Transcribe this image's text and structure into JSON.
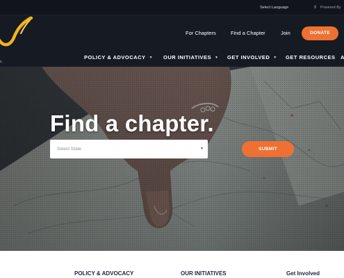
{
  "utility": {
    "language_label": "Select Language",
    "powered_by": "Powered By"
  },
  "header": {
    "logo_icon": "swoosh-logo",
    "logo_fragment": "c.",
    "top_links": [
      "For Chapters",
      "Find a Chapter",
      "Join"
    ],
    "donate_label": "DONATE",
    "main_nav": [
      {
        "label": "POLICY & ADVOCACY",
        "has_dropdown": true
      },
      {
        "label": "OUR INITIATIVES",
        "has_dropdown": true
      },
      {
        "label": "GET INVOLVED",
        "has_dropdown": true
      },
      {
        "label": "GET RESOURCES",
        "has_dropdown": false
      },
      {
        "label": "A",
        "has_dropdown": false
      }
    ]
  },
  "hero": {
    "title": "Find a chapter.",
    "state_placeholder": "Select State",
    "submit_label": "SUBMIT",
    "image_subject": "hand-pointing-at-map"
  },
  "footer": {
    "headings": [
      "POLICY & ADVOCACY",
      "OUR INITIATIVES",
      "Get Involved"
    ]
  },
  "colors": {
    "accent": "#ee7133",
    "header_bg": "#161a23",
    "utility_bg": "#11141c",
    "footer_heading": "#1b2340",
    "logo_gold": "#f2b21f"
  }
}
